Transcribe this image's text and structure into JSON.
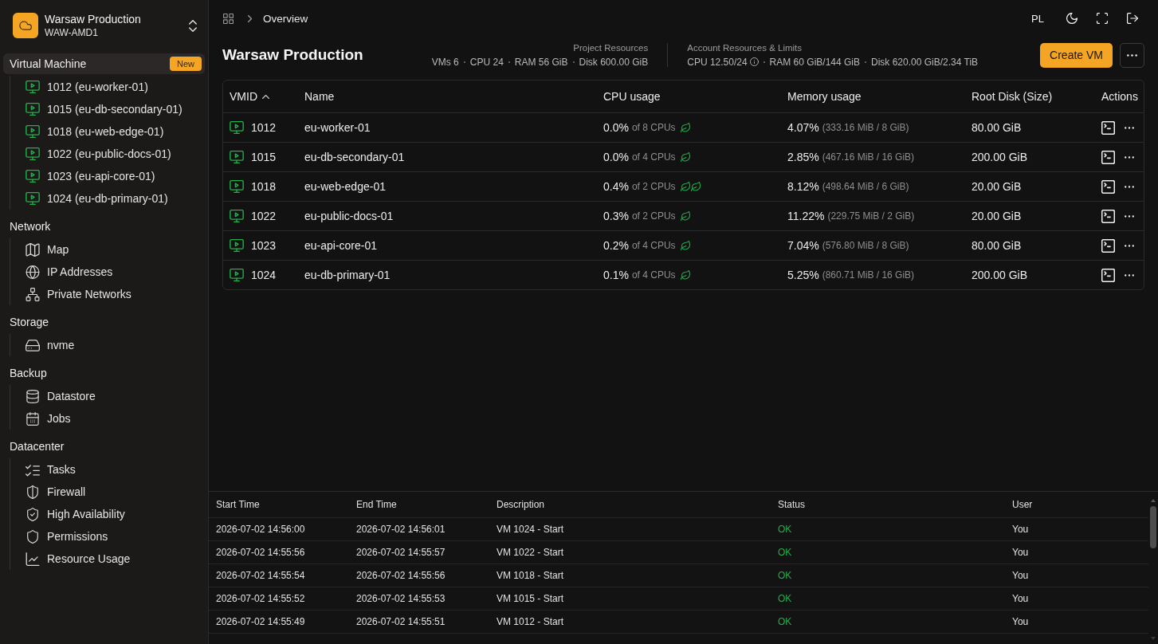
{
  "sidebar": {
    "project": {
      "name": "Warsaw Production",
      "code": "WAW-AMD1"
    },
    "sections": [
      {
        "label": "Virtual Machine",
        "selected": true,
        "badge": "New",
        "items": [
          {
            "kind": "vm",
            "label": "1012 (eu-worker-01)",
            "running": true
          },
          {
            "kind": "vm",
            "label": "1015 (eu-db-secondary-01)",
            "running": true
          },
          {
            "kind": "vm",
            "label": "1018 (eu-web-edge-01)",
            "running": true
          },
          {
            "kind": "vm",
            "label": "1022 (eu-public-docs-01)",
            "running": true
          },
          {
            "kind": "vm",
            "label": "1023 (eu-api-core-01)",
            "running": true
          },
          {
            "kind": "vm",
            "label": "1024 (eu-db-primary-01)",
            "running": true
          }
        ]
      },
      {
        "label": "Network",
        "selected": false,
        "items": [
          {
            "kind": "map",
            "label": "Map"
          },
          {
            "kind": "ip",
            "label": "IP Addresses"
          },
          {
            "kind": "private-network",
            "label": "Private Networks"
          }
        ]
      },
      {
        "label": "Storage",
        "selected": false,
        "items": [
          {
            "kind": "storage",
            "label": "nvme"
          }
        ]
      },
      {
        "label": "Backup",
        "selected": false,
        "items": [
          {
            "kind": "datastore",
            "label": "Datastore"
          },
          {
            "kind": "jobs",
            "label": "Jobs"
          }
        ]
      },
      {
        "label": "Datacenter",
        "selected": false,
        "items": [
          {
            "kind": "tasks",
            "label": "Tasks"
          },
          {
            "kind": "firewall",
            "label": "Firewall"
          },
          {
            "kind": "ha",
            "label": "High Availability"
          },
          {
            "kind": "permissions",
            "label": "Permissions"
          },
          {
            "kind": "usage",
            "label": "Resource Usage"
          }
        ]
      }
    ]
  },
  "topbar": {
    "breadcrumb": [
      {
        "label": "Overview"
      }
    ],
    "language": "PL"
  },
  "header": {
    "title": "Warsaw Production",
    "project_resources": {
      "label": "Project Resources",
      "stats": [
        "VMs 6",
        "CPU 24",
        "RAM 56 GiB",
        "Disk 600.00 GiB"
      ]
    },
    "account_resources": {
      "label": "Account Resources & Limits",
      "stats": [
        {
          "text": "CPU 12.50/24",
          "info": true
        },
        {
          "text": "RAM 60 GiB/144 GiB",
          "info": false
        },
        {
          "text": "Disk 620.00 GiB/2.34 TiB",
          "info": false
        }
      ]
    },
    "primary_button": "Create VM"
  },
  "table": {
    "columns": [
      {
        "label": "VMID",
        "sorted": true
      },
      {
        "label": "Name",
        "sorted": false
      },
      {
        "label": "CPU usage",
        "sorted": false
      },
      {
        "label": "Memory usage",
        "sorted": false
      },
      {
        "label": "Root Disk (Size)",
        "sorted": false
      },
      {
        "label": "Actions",
        "sorted": false
      }
    ],
    "rows": [
      {
        "vmid": "1012",
        "name": "eu-worker-01",
        "running": true,
        "cpu": "0.0%",
        "cpu_total": "of 8 CPUs",
        "indicators": [
          {
            "kind": "leaf"
          }
        ],
        "memory": "4.07%",
        "memory_detail": "(333.16 MiB / 8 GiB)",
        "root_disk": "80.00 GiB"
      },
      {
        "vmid": "1015",
        "name": "eu-db-secondary-01",
        "running": true,
        "cpu": "0.0%",
        "cpu_total": "of 4 CPUs",
        "indicators": [
          {
            "kind": "leaf"
          }
        ],
        "memory": "2.85%",
        "memory_detail": "(467.16 MiB / 16 GiB)",
        "root_disk": "200.00 GiB"
      },
      {
        "vmid": "1018",
        "name": "eu-web-edge-01",
        "running": true,
        "cpu": "0.4%",
        "cpu_total": "of 2 CPUs",
        "indicators": [
          {
            "kind": "leaf"
          },
          {
            "kind": "leaf"
          }
        ],
        "memory": "8.12%",
        "memory_detail": "(498.64 MiB / 6 GiB)",
        "root_disk": "20.00 GiB"
      },
      {
        "vmid": "1022",
        "name": "eu-public-docs-01",
        "running": true,
        "cpu": "0.3%",
        "cpu_total": "of 2 CPUs",
        "indicators": [
          {
            "kind": "leaf"
          }
        ],
        "memory": "11.22%",
        "memory_detail": "(229.75 MiB / 2 GiB)",
        "root_disk": "20.00 GiB"
      },
      {
        "vmid": "1023",
        "name": "eu-api-core-01",
        "running": true,
        "cpu": "0.2%",
        "cpu_total": "of 4 CPUs",
        "indicators": [
          {
            "kind": "leaf"
          }
        ],
        "memory": "7.04%",
        "memory_detail": "(576.80 MiB / 8 GiB)",
        "root_disk": "80.00 GiB"
      },
      {
        "vmid": "1024",
        "name": "eu-db-primary-01",
        "running": true,
        "cpu": "0.1%",
        "cpu_total": "of 4 CPUs",
        "indicators": [
          {
            "kind": "leaf"
          }
        ],
        "memory": "5.25%",
        "memory_detail": "(860.71 MiB / 16 GiB)",
        "root_disk": "200.00 GiB"
      }
    ]
  },
  "tasks": {
    "columns": [
      "Start Time",
      "End Time",
      "Description",
      "Status",
      "User"
    ],
    "rows": [
      {
        "start": "2026-07-02 14:56:00",
        "end": "2026-07-02 14:56:01",
        "description": "VM 1024 - Start",
        "status": "OK",
        "ok": true,
        "user": "You"
      },
      {
        "start": "2026-07-02 14:55:56",
        "end": "2026-07-02 14:55:57",
        "description": "VM 1022 - Start",
        "status": "OK",
        "ok": true,
        "user": "You"
      },
      {
        "start": "2026-07-02 14:55:54",
        "end": "2026-07-02 14:55:56",
        "description": "VM 1018 - Start",
        "status": "OK",
        "ok": true,
        "user": "You"
      },
      {
        "start": "2026-07-02 14:55:52",
        "end": "2026-07-02 14:55:53",
        "description": "VM 1015 - Start",
        "status": "OK",
        "ok": true,
        "user": "You"
      },
      {
        "start": "2026-07-02 14:55:49",
        "end": "2026-07-02 14:55:51",
        "description": "VM 1012 - Start",
        "status": "OK",
        "ok": true,
        "user": "You"
      }
    ]
  }
}
